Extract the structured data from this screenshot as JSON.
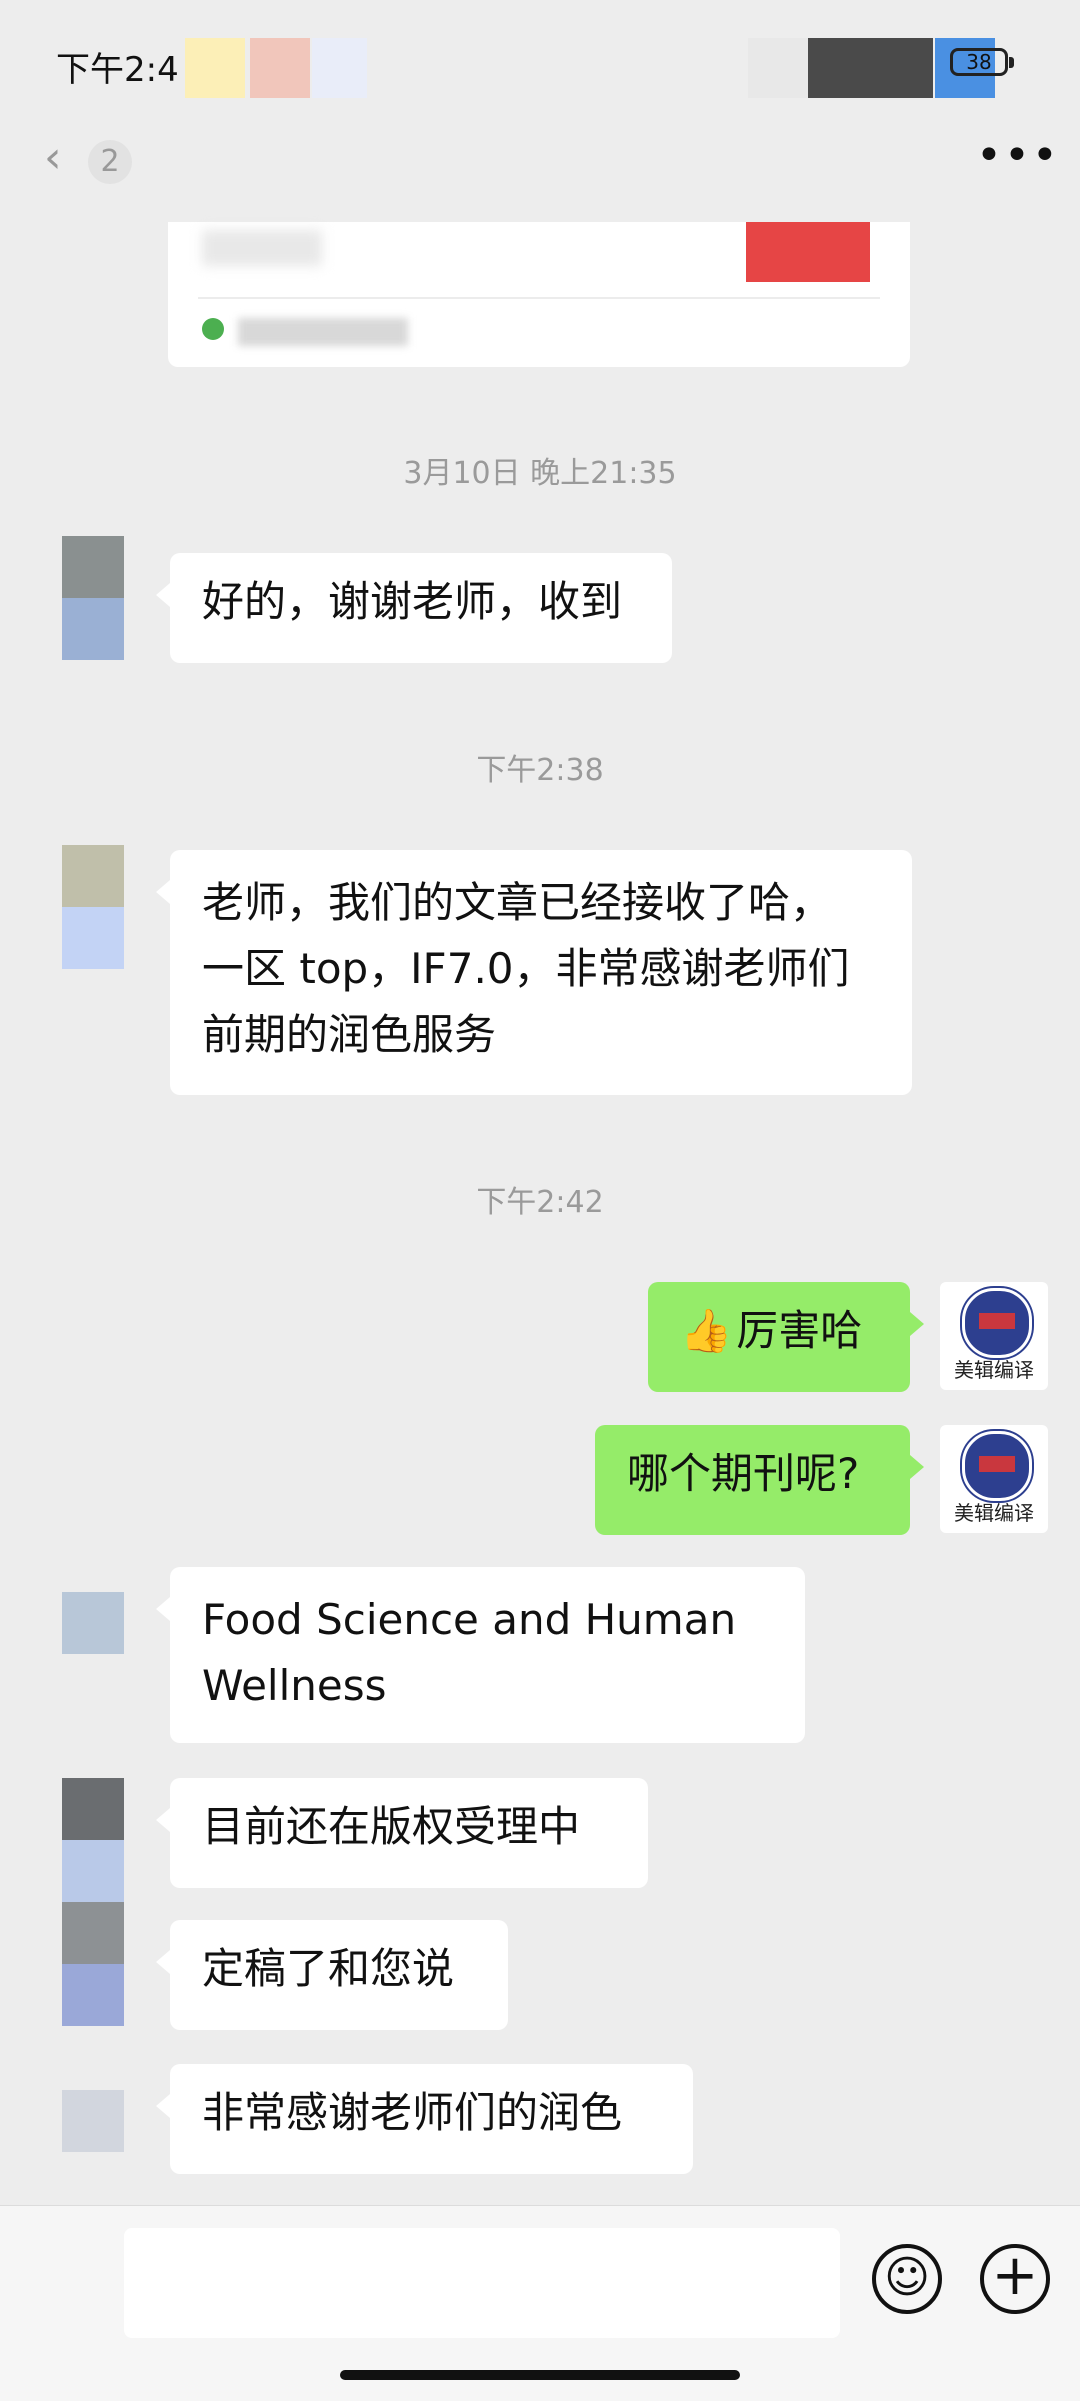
{
  "status_bar": {
    "time": "下午2:4",
    "battery": "38"
  },
  "nav": {
    "back_icon": "‹",
    "unread_count": "2",
    "more_icon": "•••"
  },
  "timestamps": {
    "t1": "3月10日 晚上21:35",
    "t2": "下午2:38",
    "t3": "下午2:42"
  },
  "messages": [
    {
      "side": "left",
      "text": "好的，谢谢老师，收到"
    },
    {
      "side": "left",
      "lines": [
        "老师，我们的文章已经接收了哈，",
        "一区 top，IF7.0，非常感谢老师们",
        "前期的润色服务"
      ]
    },
    {
      "side": "right",
      "emoji": "👍",
      "text": "厉害哈"
    },
    {
      "side": "right",
      "text": "哪个期刊呢?"
    },
    {
      "side": "left",
      "lines": [
        "Food Science and Human",
        "Wellness"
      ]
    },
    {
      "side": "left",
      "text": "目前还在版权受理中"
    },
    {
      "side": "left",
      "text": "定稿了和您说"
    },
    {
      "side": "left",
      "text": "非常感谢老师们的润色"
    }
  ],
  "self_avatar": {
    "logo_text": "美辑编译"
  },
  "input": {
    "emoji_icon": "☺",
    "plus_icon": "+"
  },
  "colors": {
    "bg": "#ededed",
    "bubble_left": "#ffffff",
    "bubble_right": "#95ec69",
    "timestamp": "#9a9a9a"
  }
}
